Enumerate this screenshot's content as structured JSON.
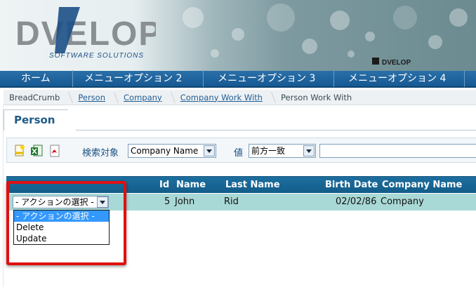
{
  "brand": {
    "logo_text": "DVELOP",
    "tagline": "SOFTWARE SOLUTIONS",
    "mini_logo_text": "DVELOP",
    "colors": {
      "menu_bg": "#175a93",
      "grid_header": "#1d6f9f",
      "row_bg": "#a9d9d6",
      "highlight": "#e01010"
    }
  },
  "menu": {
    "items": [
      {
        "label": "ホーム"
      },
      {
        "label": "メニューオプション 2"
      },
      {
        "label": "メニューオプション 3"
      },
      {
        "label": "メニューオプション 4"
      }
    ]
  },
  "breadcrumb": {
    "items": [
      {
        "label": "BreadCrumb"
      },
      {
        "label": "Person"
      },
      {
        "label": "Company"
      },
      {
        "label": "Company Work With"
      },
      {
        "label": "Person Work With"
      }
    ]
  },
  "tab": {
    "title": "Person"
  },
  "search": {
    "icons": [
      "new-icon",
      "excel-icon",
      "pdf-icon"
    ],
    "search_label": "検索対象",
    "search_field_value": "Company Name",
    "value_label": "値",
    "match_value": "前方一致",
    "text_value": ""
  },
  "grid": {
    "headers": [
      "Id",
      "Name",
      "Last Name",
      "Birth Date",
      "Company Name"
    ],
    "rows": [
      {
        "id": "5",
        "name": "John",
        "last_name": "Rid",
        "birth_date": "02/02/86",
        "company": "Company"
      }
    ]
  },
  "actions": {
    "selected": "- アクションの選択 -",
    "options": [
      "- アクションの選択 -",
      "Delete",
      "Update"
    ]
  }
}
